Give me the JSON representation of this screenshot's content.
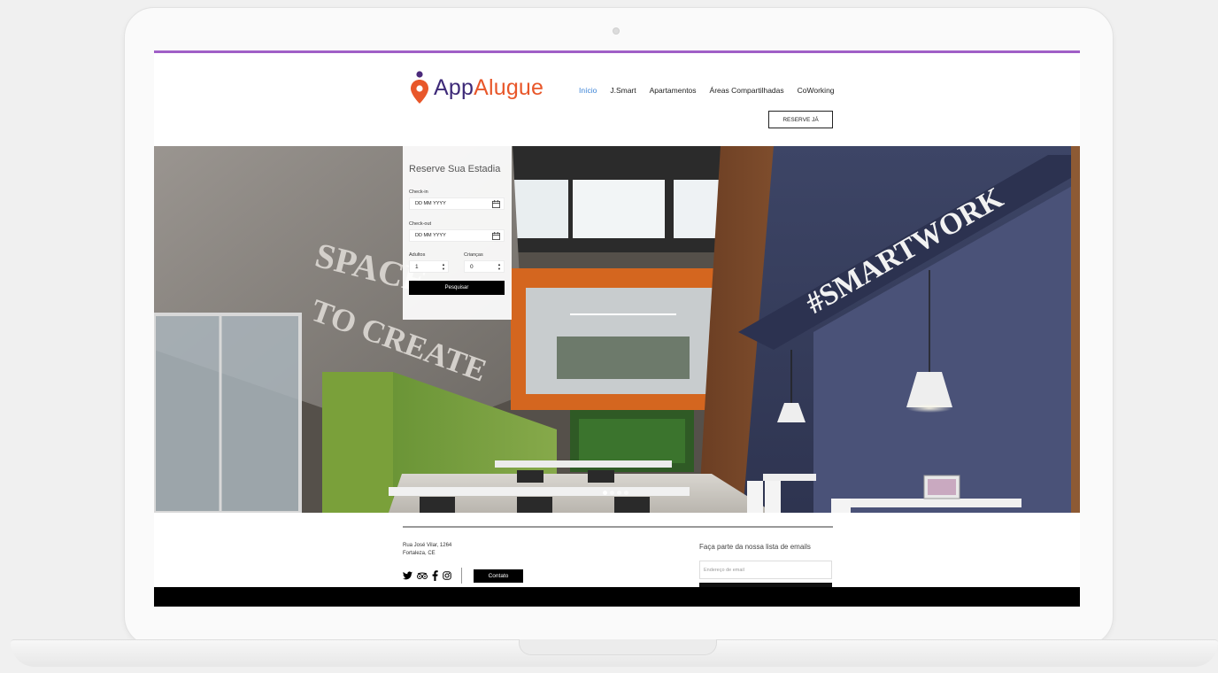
{
  "colors": {
    "accent_bar": "#a05fc7",
    "logo_pin": "#e8572a",
    "logo_dot": "#4b2a7b",
    "logo_app": "#3e2a78",
    "logo_alugue": "#e8572a",
    "nav_active": "#3b83d6"
  },
  "brand": {
    "part1": "App",
    "part2": "Alugue"
  },
  "nav": {
    "items": [
      {
        "label": "Início",
        "active": true
      },
      {
        "label": "J.Smart",
        "active": false
      },
      {
        "label": "Apartamentos",
        "active": false
      },
      {
        "label": "Áreas Compartilhadas",
        "active": false
      },
      {
        "label": "CoWorking",
        "active": false
      }
    ],
    "cta_label": "RESERVE JÁ"
  },
  "hero": {
    "wall_text_1": "SPACE",
    "wall_text_2": "TO CREATE",
    "sign_text": "#SMARTWORK",
    "slides_count": 4,
    "active_slide": 1
  },
  "booking": {
    "title": "Reserve Sua Estadia",
    "checkin_label": "Check-in",
    "checkin_placeholder": "DD MM YYYY",
    "checkout_label": "Check-out",
    "checkout_placeholder": "DD MM YYYY",
    "adults_label": "Adultos",
    "adults_value": "1",
    "children_label": "Crianças",
    "children_value": "0",
    "search_label": "Pesquisar"
  },
  "footer": {
    "address_line1": "Rua José Vilar, 1264",
    "address_line2": "Fortaleza, CE",
    "contact_label": "Contato",
    "newsletter_label": "Faça parte da nossa lista de emails",
    "email_placeholder": "Endereço de email",
    "social_icons": [
      "twitter-icon",
      "tripadvisor-icon",
      "facebook-icon",
      "instagram-icon"
    ]
  }
}
